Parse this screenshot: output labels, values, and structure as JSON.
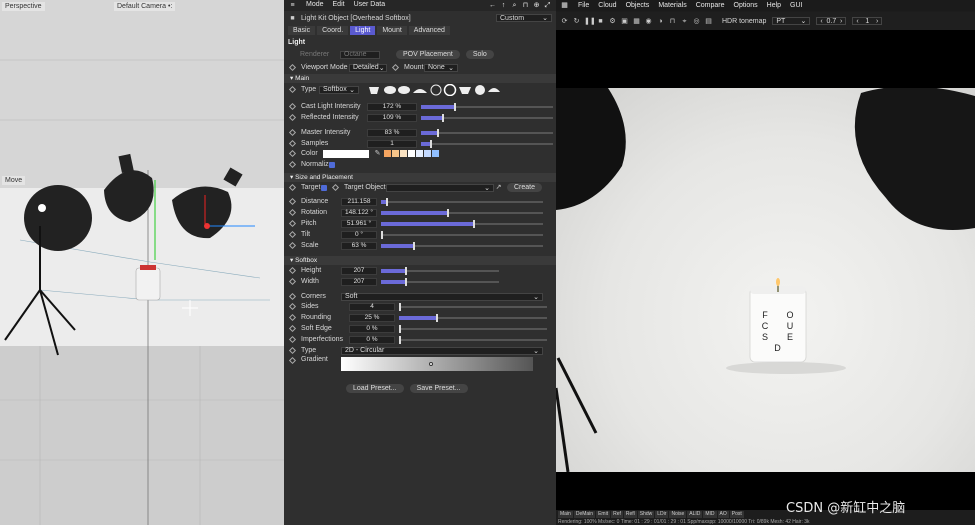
{
  "viewport": {
    "label_left": "Perspective",
    "label_center": "Default Camera •:",
    "label_move": "Move"
  },
  "attr": {
    "menu": [
      "Mode",
      "Edit",
      "User Data"
    ],
    "title": "Light Kit Object [Overhead Softbox]",
    "preset": "Custom",
    "tabs": [
      "Basic",
      "Coord.",
      "Light",
      "Mount",
      "Advanced"
    ],
    "section_light": "Light",
    "renderer_label": "Renderer",
    "renderer_value": "Octane",
    "pov_button": "POV Placement",
    "solo_button": "Solo",
    "viewport_mode_label": "Viewport Mode",
    "viewport_mode_value": "Detailed",
    "mount_label": "Mount",
    "mount_value": "None",
    "section_main": "▾ Main",
    "type_label": "Type",
    "type_value": "Softbox",
    "cast": {
      "label": "Cast Light Intensity",
      "value": "172 %",
      "level": 0.25
    },
    "refl": {
      "label": "Reflected Intensity",
      "value": "109 %",
      "level": 0.16
    },
    "master": {
      "label": "Master Intensity",
      "value": "83 %",
      "level": 0.12
    },
    "samples": {
      "label": "Samples",
      "value": "1",
      "level": 0.07
    },
    "color_label": "Color",
    "color_swatches": [
      "#f4a460",
      "#f7c58a",
      "#fbe3c2",
      "#ffffff",
      "#e6efff",
      "#c3d9ff",
      "#90bfff"
    ],
    "normalize_label": "Normalize",
    "section_size": "▾ Size and Placement",
    "target_label": "Target",
    "target_object_label": "Target Object",
    "create_button": "Create",
    "distance": {
      "label": "Distance",
      "value": "211.158",
      "level": 0.03
    },
    "rotation": {
      "label": "Rotation",
      "value": "148.122 °",
      "level": 0.41
    },
    "pitch": {
      "label": "Pitch",
      "value": "51.961 °",
      "level": 0.57
    },
    "tilt": {
      "label": "Tilt",
      "value": "0 °",
      "level": 0.0
    },
    "scale": {
      "label": "Scale",
      "value": "63 %",
      "level": 0.2
    },
    "section_softbox": "▾ Softbox",
    "height": {
      "label": "Height",
      "value": "207",
      "level": 0.2
    },
    "width": {
      "label": "Width",
      "value": "207",
      "level": 0.2
    },
    "corners_label": "Corners",
    "corners_value": "Soft",
    "sides": {
      "label": "Sides",
      "value": "4",
      "level": 0.0
    },
    "rounding": {
      "label": "Rounding",
      "value": "25 %",
      "level": 0.25
    },
    "softedge": {
      "label": "Soft Edge",
      "value": "0 %",
      "level": 0.0
    },
    "imperf": {
      "label": "Imperfections",
      "value": "0 %",
      "level": 0.0
    },
    "type2_label": "Type",
    "type2_value": "2D - Circular",
    "gradient_label": "Gradient",
    "load_button": "Load Preset...",
    "save_button": "Save Preset..."
  },
  "render": {
    "menu": [
      "File",
      "Cloud",
      "Objects",
      "Materials",
      "Compare",
      "Options",
      "Help",
      "GUI"
    ],
    "tonemap": "HDR tonemap",
    "pt": "PT",
    "num1": "0.7",
    "num2": "1",
    "candle_text": [
      "F",
      "O",
      "C",
      "U",
      "S",
      "E",
      "D"
    ],
    "bottom_tabs": [
      "Main",
      "DeMain",
      "Emit",
      "Ref",
      "Refl",
      "Shdw",
      "LDir",
      "Noise",
      "ALID",
      "MID",
      "AO",
      "Post"
    ],
    "status": "Rendering: 100%   Ms/sec: 0   Time: 01 : 29 : 01/01 : 29 : 01   Spp/maxspp: 10000/10000   Tri: 0/89k   Mesh: 42   Hair: 3k",
    "watermark": "CSDN @新缸中之脑"
  },
  "colors": {
    "accent": "#5a5ad0",
    "slider": "#6b6ad8"
  }
}
